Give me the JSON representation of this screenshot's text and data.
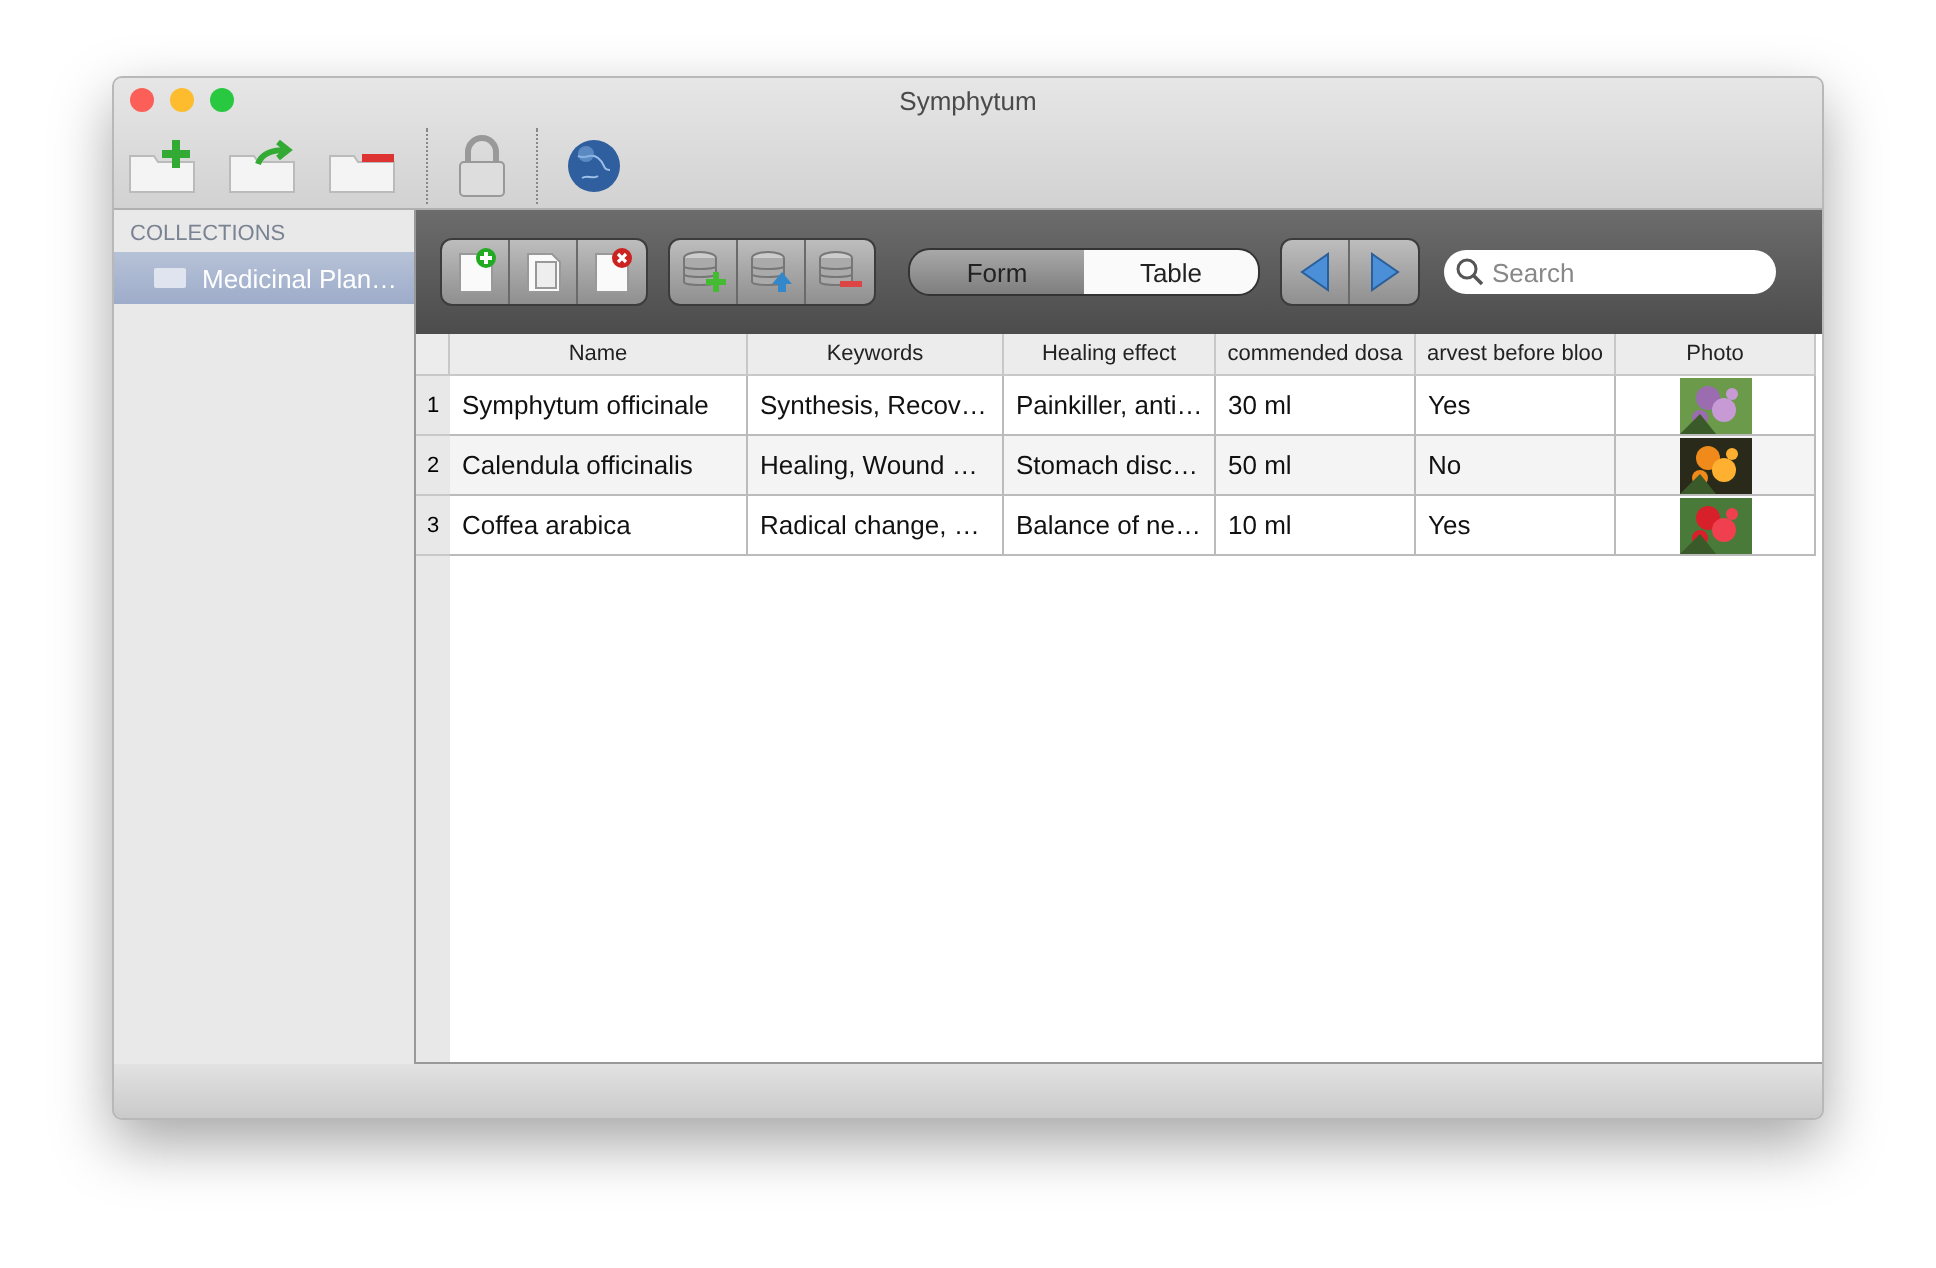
{
  "window": {
    "title": "Symphytum"
  },
  "sidebar": {
    "heading": "COLLECTIONS",
    "items": [
      {
        "label": "Medicinal Plan…",
        "selected": true
      }
    ]
  },
  "view_switch": [
    {
      "label": "Form",
      "selected": false
    },
    {
      "label": "Table",
      "selected": true
    }
  ],
  "search": {
    "placeholder": "Search"
  },
  "table": {
    "columns": [
      "Name",
      "Keywords",
      "Healing effect",
      "commended dosa",
      "arvest before bloo",
      "Photo"
    ],
    "rows": [
      {
        "number": "1",
        "cells": [
          "Symphytum officinale",
          "Synthesis, Recov…",
          "Painkiller, anti…",
          "30 ml",
          "Yes"
        ],
        "photo": {
          "kind": "picture"
        }
      },
      {
        "number": "2",
        "cells": [
          "Calendula officinalis",
          "Healing, Wound …",
          "Stomach disc…",
          "50 ml",
          "No"
        ],
        "photo": {
          "kind": "picture"
        }
      },
      {
        "number": "3",
        "cells": [
          "Coffea arabica",
          "Radical change, …",
          "Balance of ne…",
          "10 ml",
          "Yes"
        ],
        "photo": {
          "kind": "picture"
        }
      }
    ]
  }
}
